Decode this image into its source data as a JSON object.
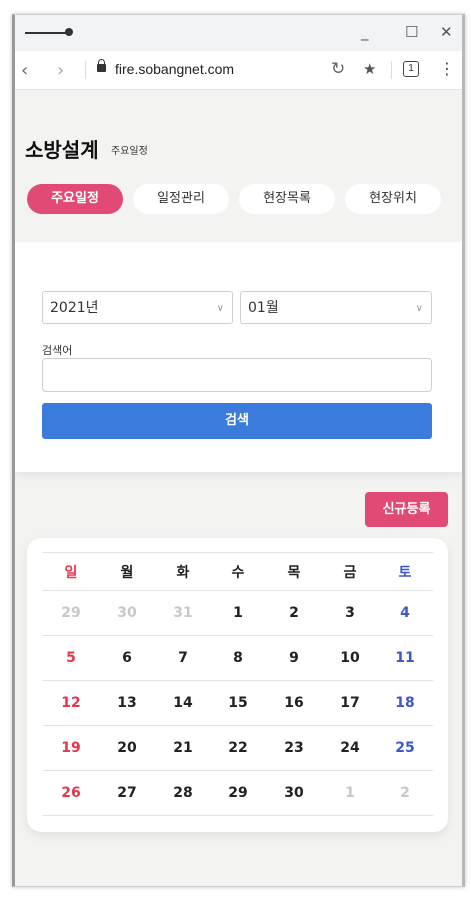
{
  "window": {
    "minimize": "_",
    "maximize": "☐",
    "close": "✕"
  },
  "browser": {
    "url": "fire.sobangnet.com",
    "tab_count": "1",
    "more": "⋮",
    "back": "‹",
    "forward": "›",
    "reload": "↻",
    "star": "★"
  },
  "page": {
    "title": "소방설계",
    "subtitle": "주요일정",
    "tabs": [
      {
        "label": "주요일정",
        "active": true
      },
      {
        "label": "일정관리",
        "active": false
      },
      {
        "label": "현장목록",
        "active": false
      },
      {
        "label": "현장위치",
        "active": false
      }
    ]
  },
  "search": {
    "year": "2021년",
    "month": "01월",
    "keyword_label": "검색어",
    "keyword_value": "",
    "button": "검색"
  },
  "new_button": "신규등록",
  "calendar": {
    "weekdays": [
      "일",
      "월",
      "화",
      "수",
      "목",
      "금",
      "토"
    ],
    "weeks": [
      [
        {
          "d": "29",
          "other": true
        },
        {
          "d": "30",
          "other": true
        },
        {
          "d": "31",
          "other": true
        },
        {
          "d": "1"
        },
        {
          "d": "2"
        },
        {
          "d": "3"
        },
        {
          "d": "4"
        }
      ],
      [
        {
          "d": "5"
        },
        {
          "d": "6"
        },
        {
          "d": "7"
        },
        {
          "d": "8"
        },
        {
          "d": "9"
        },
        {
          "d": "10"
        },
        {
          "d": "11"
        }
      ],
      [
        {
          "d": "12"
        },
        {
          "d": "13"
        },
        {
          "d": "14"
        },
        {
          "d": "15"
        },
        {
          "d": "16"
        },
        {
          "d": "17"
        },
        {
          "d": "18"
        }
      ],
      [
        {
          "d": "19"
        },
        {
          "d": "20"
        },
        {
          "d": "21"
        },
        {
          "d": "22"
        },
        {
          "d": "23"
        },
        {
          "d": "24"
        },
        {
          "d": "25"
        }
      ],
      [
        {
          "d": "26"
        },
        {
          "d": "27"
        },
        {
          "d": "28"
        },
        {
          "d": "29"
        },
        {
          "d": "30"
        },
        {
          "d": "1",
          "other": true
        },
        {
          "d": "2",
          "other": true
        }
      ]
    ]
  },
  "colors": {
    "accent_pink": "#e24a76",
    "primary_blue": "#3a7bdc",
    "sunday": "#e8344c",
    "saturday": "#3c57c9"
  }
}
